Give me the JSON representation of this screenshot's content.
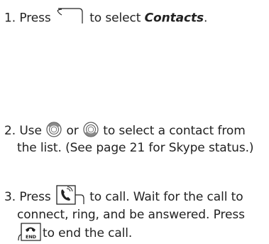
{
  "steps": [
    {
      "number": "1.",
      "pre": "Press",
      "mid": "to select",
      "emphasis": "Contacts",
      "post": ".",
      "icon": "softkey-icon"
    },
    {
      "number": "2.",
      "line1_pre": "Use",
      "line1_or": "or",
      "line1_post": "to select a contact from",
      "line2": "the list. (See page 21 for Skype status.)",
      "icons": [
        "nav-up-icon",
        "nav-down-icon"
      ]
    },
    {
      "number": "3.",
      "line1_pre": "Press",
      "line1_post": "to call. Wait for the call to",
      "line2": "connect, ring, and be answered. Press",
      "line3_post": "to end the call.",
      "icons": [
        "talk-key-icon",
        "end-key-icon"
      ],
      "end_key_label": "END"
    }
  ]
}
